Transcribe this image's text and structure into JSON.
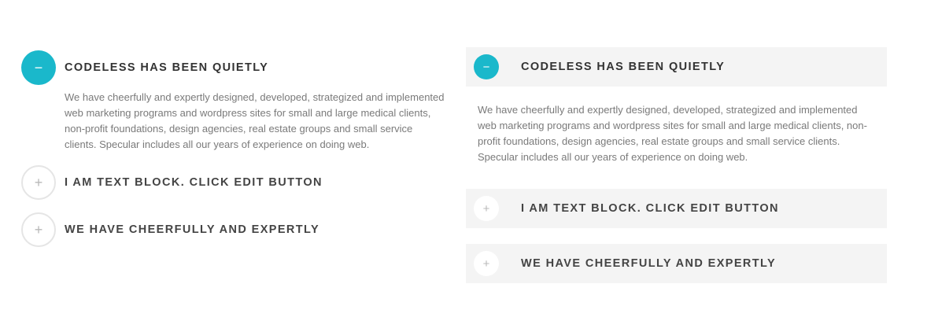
{
  "colors": {
    "accent": "#1ab8cb",
    "title": "#333333",
    "body_text": "#7a7a7a",
    "box_bg": "#f4f4f4",
    "icon_border": "#e5e5e5"
  },
  "icons": {
    "open": "minus-icon",
    "closed": "plus-icon",
    "open_glyph": "−",
    "closed_glyph": "+"
  },
  "left_accordion": {
    "items": [
      {
        "title": "CODELESS HAS BEEN QUIETLY",
        "expanded": true,
        "body": "We have cheerfully and expertly designed, developed, strategized and implemented web marketing programs and wordpress sites for small and large medical clients, non-profit foundations, design agencies, real estate groups and small service clients. Specular includes all our years of experience on doing web."
      },
      {
        "title": "I AM TEXT BLOCK. CLICK EDIT BUTTON",
        "expanded": false
      },
      {
        "title": "WE HAVE CHEERFULLY AND EXPERTLY",
        "expanded": false
      }
    ]
  },
  "right_accordion": {
    "items": [
      {
        "title": "CODELESS HAS BEEN QUIETLY",
        "expanded": true,
        "body": "We have cheerfully and expertly designed, developed, strategized and implemented web marketing programs and wordpress sites for small and large medical clients, non-profit foundations, design agencies, real estate groups and small service clients. Specular includes all our years of experience on doing web."
      },
      {
        "title": "I AM TEXT BLOCK. CLICK EDIT BUTTON",
        "expanded": false
      },
      {
        "title": "WE HAVE CHEERFULLY AND EXPERTLY",
        "expanded": false
      }
    ]
  }
}
